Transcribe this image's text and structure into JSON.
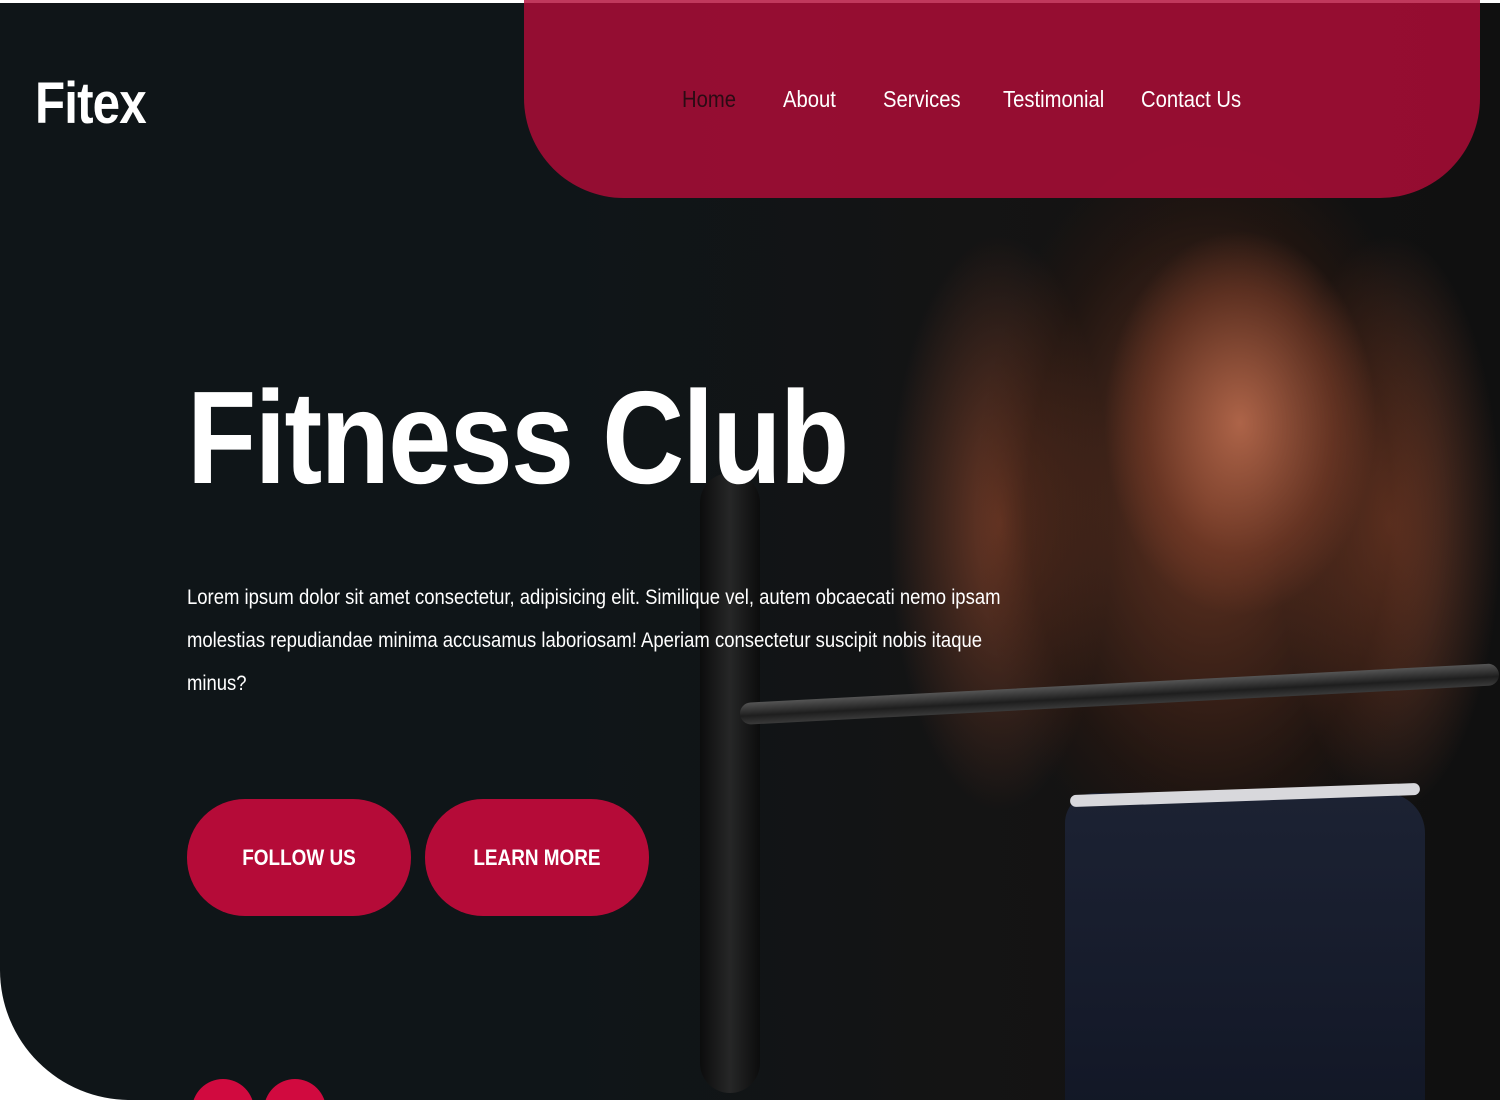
{
  "brand": {
    "logo": "Fitex"
  },
  "nav": {
    "items": [
      {
        "label": "Home",
        "active": true
      },
      {
        "label": "About",
        "active": false
      },
      {
        "label": "Services",
        "active": false
      },
      {
        "label": "Testimonial",
        "active": false
      },
      {
        "label": "Contact Us",
        "active": false
      }
    ]
  },
  "hero": {
    "title": "Fitness Club",
    "description": "Lorem ipsum dolor sit amet consectetur, adipisicing elit. Similique vel, autem obcaecati nemo ipsam molestias repudiandae minima accusamus laboriosam! Aperiam consectetur suscipit nobis itaque minus?",
    "buttons": {
      "follow": "FOLLOW US",
      "learn": "LEARN MORE"
    },
    "image": "athlete-barbell-photo"
  },
  "colors": {
    "accent": "#b50b38",
    "nav_panel": "#b20c38",
    "background": "#0f1518",
    "text": "#ffffff",
    "active_nav_text": "#2a0b14"
  }
}
